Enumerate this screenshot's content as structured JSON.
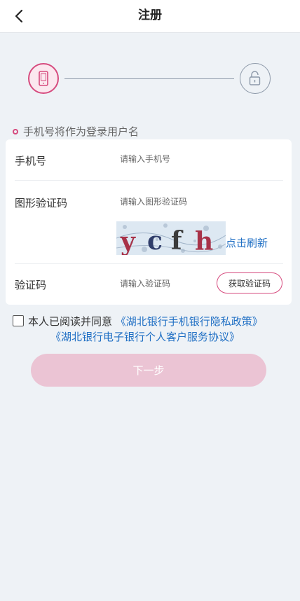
{
  "header": {
    "title": "注册",
    "back_icon": "chevron-left-icon"
  },
  "steps": {
    "step1_icon": "phone-icon",
    "step2_icon": "lock-icon",
    "active_color": "#d64b7e",
    "inactive_color": "#8c98a8"
  },
  "hint": "手机号将作为登录用户名",
  "form": {
    "phone_label": "手机号",
    "phone_placeholder": "请输入手机号",
    "captcha_label": "图形验证码",
    "captcha_placeholder": "请输入图形验证码",
    "captcha_text": "ycfh",
    "refresh_label": "点击刷新",
    "sms_label": "验证码",
    "sms_placeholder": "请输入验证码",
    "get_code_button": "获取验证码"
  },
  "agreement": {
    "prefix": "本人已阅读并同意",
    "privacy_link": "《湖北银行手机银行隐私政策》",
    "service_link": "《湖北银行电子银行个人客户服务协议》",
    "link_color": "#1f6fc4"
  },
  "next_button": "下一步"
}
